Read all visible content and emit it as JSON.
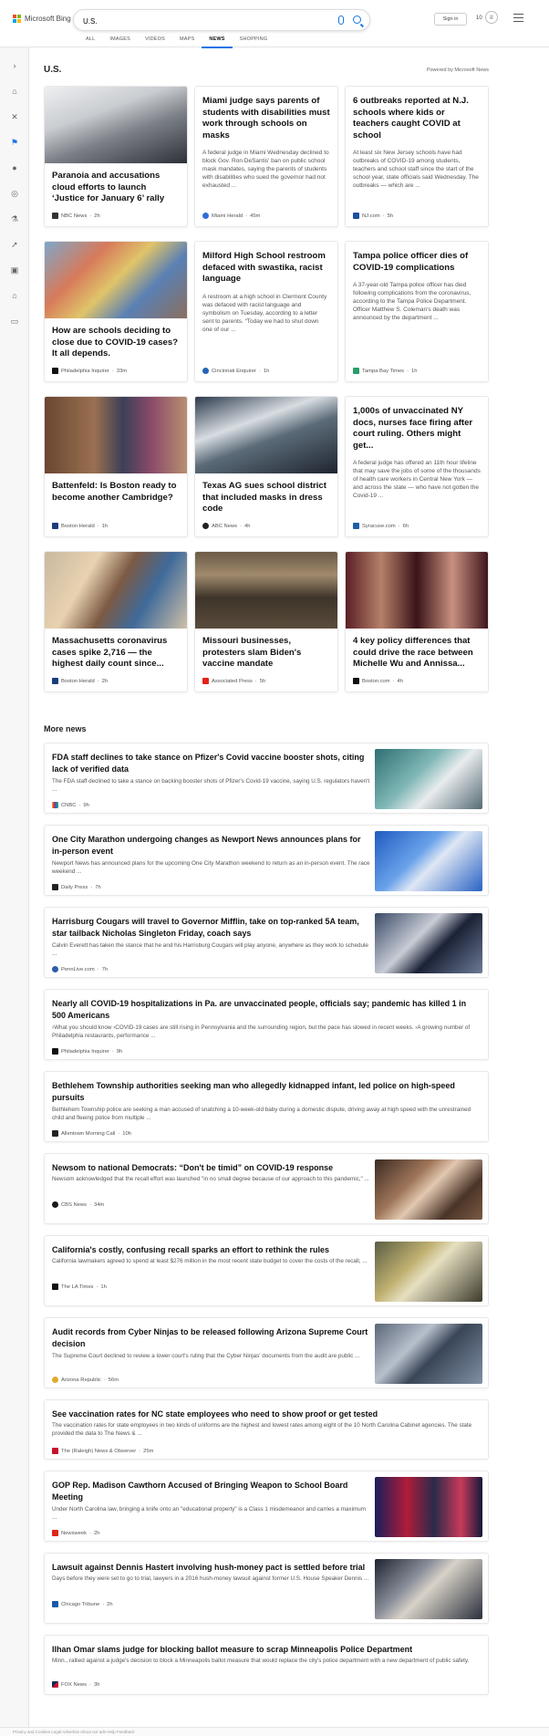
{
  "header": {
    "logo_text": "Microsoft Bing",
    "search_value": "U.S.",
    "signin_label": "Sign in",
    "points": "10",
    "tabs": [
      {
        "label": "ALL"
      },
      {
        "label": "IMAGES"
      },
      {
        "label": "VIDEOS"
      },
      {
        "label": "MAPS"
      },
      {
        "label": "NEWS"
      },
      {
        "label": "SHOPPING"
      }
    ],
    "active_tab": "NEWS"
  },
  "section": {
    "title": "U.S.",
    "powered_by": "Powered by Microsoft News"
  },
  "top_stories": [
    {
      "title": "Paranoia and accusations cloud efforts to launch ‘Justice for January 6’ rally",
      "snippet": "",
      "provider": "NBC News",
      "age": "2h"
    },
    {
      "title": "Miami judge says parents of students with disabilities must work through schools on masks",
      "snippet": "A federal judge in Miami Wednesday declined to block Gov. Ron DeSantis' ban on public school mask mandates, saying the parents of students with disabilities who sued the governor had not exhausted ...",
      "provider": "Miami Herald",
      "age": "45m"
    },
    {
      "title": "6 outbreaks reported at N.J. schools where kids or teachers caught COVID at school",
      "snippet": "At least six New Jersey schools have had outbreaks of COVID-19 among students, teachers and school staff since the start of the school year, state officials said Wednesday. The outbreaks — which are ...",
      "provider": "NJ.com",
      "age": "5h"
    },
    {
      "title": "How are schools deciding to close due to COVID-19 cases? It all depends.",
      "snippet": "",
      "provider": "Philadelphia Inquirer",
      "age": "33m"
    },
    {
      "title": "Milford High School restroom defaced with swastika, racist language",
      "snippet": "A restroom at a high school in Clermont County was defaced with racist language and symbolism on Tuesday, according to a letter sent to parents. “Today we had to shut down one of our ...",
      "provider": "Cincinnati Enquirer",
      "age": "1h"
    },
    {
      "title": "Tampa police officer dies of COVID-19 complications",
      "snippet": "A 37-year-old Tampa police officer has died following complications from the coronavirus, according to the Tampa Police Department. Officer Matthew S. Coleman's death was announced by the department ...",
      "provider": "Tampa Bay Times",
      "age": "1h"
    },
    {
      "title": "Battenfeld: Is Boston ready to become another Cambridge?",
      "snippet": "",
      "provider": "Boston Herald",
      "age": "1h"
    },
    {
      "title": "Texas AG sues school district that included masks in dress code",
      "snippet": "",
      "provider": "ABC News",
      "age": "4h"
    },
    {
      "title": "1,000s of unvaccinated NY docs, nurses face firing after court ruling. Others might get...",
      "snippet": "A federal judge has offered an 11th hour lifeline that may save the jobs of some of the thousands of health care workers in Central New York — and across the state — who have not gotten the Covid-19 ...",
      "provider": "Syracuse.com",
      "age": "6h"
    },
    {
      "title": "Massachusetts coronavirus cases spike 2,716 — the highest daily count since...",
      "snippet": "",
      "provider": "Boston Herald",
      "age": "2h"
    },
    {
      "title": "Missouri businesses, protesters slam Biden's vaccine mandate",
      "snippet": "",
      "provider": "Associated Press",
      "age": "5h"
    },
    {
      "title": "4 key policy differences that could drive the race between Michelle Wu and Annissa...",
      "snippet": "",
      "provider": "Boston.com",
      "age": "4h"
    }
  ],
  "more_news": {
    "title": "More news",
    "items": [
      {
        "title": "FDA staff declines to take stance on Pfizer's Covid vaccine booster shots, citing lack of verified data",
        "snippet": "The FDA staff declined to take a stance on backing booster shots of Pfizer's Covid-19 vaccine, saying U.S. regulators haven't ...",
        "provider": "CNBC",
        "age": "9h"
      },
      {
        "title": "One City Marathon undergoing changes as Newport News announces plans for in-person event",
        "snippet": "Newport News has announced plans for the upcoming One City Marathon weekend to return as an in-person event. The race weekend ...",
        "provider": "Daily Press",
        "age": "7h"
      },
      {
        "title": "Harrisburg Cougars will travel to Governor Mifflin, take on top-ranked 5A team, star tailback Nicholas Singleton Friday, coach says",
        "snippet": "Calvin Everett has taken the stance that he and his Harrisburg Cougars will play anyone, anywhere as they work to schedule ...",
        "provider": "PennLive.com",
        "age": "7h"
      },
      {
        "title": "Nearly all COVID-19 hospitalizations in Pa. are unvaccinated people, officials say; pandemic has killed 1 in 500 Americans",
        "snippet": "›What you should know ›COVID-19 cases are still rising in Pennsylvania and the surrounding region, but the pace has slowed in recent weeks. ›A growing number of Philadelphia restaurants, performance ...",
        "provider": "Philadelphia Inquirer",
        "age": "9h"
      },
      {
        "title": "Bethlehem Township authorities seeking man who allegedly kidnapped infant, led police on high-speed pursuits",
        "snippet": "Bethlehem Township police are seeking a man accused of snatching a 10-week-old baby during a domestic dispute, driving away at high speed with the unrestrained child and fleeing police from multiple ...",
        "provider": "Allentown Morning Call",
        "age": "10h"
      },
      {
        "title": "Newsom to national Democrats: “Don't be timid” on COVID-19 response",
        "snippet": "Newsom acknowledged that the recall effort was launched \"in no small degree because of our approach to this pandemic,\" ...",
        "provider": "CBS News",
        "age": "34m"
      },
      {
        "title": "California's costly, confusing recall sparks an effort to rethink the rules",
        "snippet": "California lawmakers agreed to spend at least $276 million in the most recent state budget to cover the costs of the recall, ...",
        "provider": "The LA Times",
        "age": "1h"
      },
      {
        "title": "Audit records from Cyber Ninjas to be released following Arizona Supreme Court decision",
        "snippet": "The Supreme Court declined to review a lower court's ruling that the Cyber Ninjas' documents from the audit are public ...",
        "provider": "Arizona Republic",
        "age": "56m"
      },
      {
        "title": "See vaccination rates for NC state employees who need to show proof or get tested",
        "snippet": "The vaccination rates for state employees in two kinds of uniforms are the highest and lowest rates among eight of the 10 North Carolina Cabinet agencies. The state provided the data to The News & ...",
        "provider": "The (Raleigh) News & Observer",
        "age": "25m"
      },
      {
        "title": "GOP Rep. Madison Cawthorn Accused of Bringing Weapon to School Board Meeting",
        "snippet": "Under North Carolina law, bringing a knife onto an \"educational property\" is a Class 1 misdemeanor and carries a maximum ...",
        "provider": "Newsweek",
        "age": "2h"
      },
      {
        "title": "Lawsuit against Dennis Hastert involving hush-money pact is settled before trial",
        "snippet": "Days before they were set to go to trial, lawyers in a 2016 hush-money lawsuit against former U.S. House Speaker Dennis ...",
        "provider": "Chicago Tribune",
        "age": "2h"
      },
      {
        "title": "Ilhan Omar slams judge for blocking ballot measure to scrap Minneapolis Police Department",
        "snippet": "Minn., rallied against a judge's decision to block a Minneapolis ballot measure that would replace the city's police department with a new department of public safety.",
        "provider": "FOX News",
        "age": "3h"
      }
    ]
  },
  "footer_text": "Privacy and Cookies   Legal   Advertise   About our ads   Help   Feedback"
}
